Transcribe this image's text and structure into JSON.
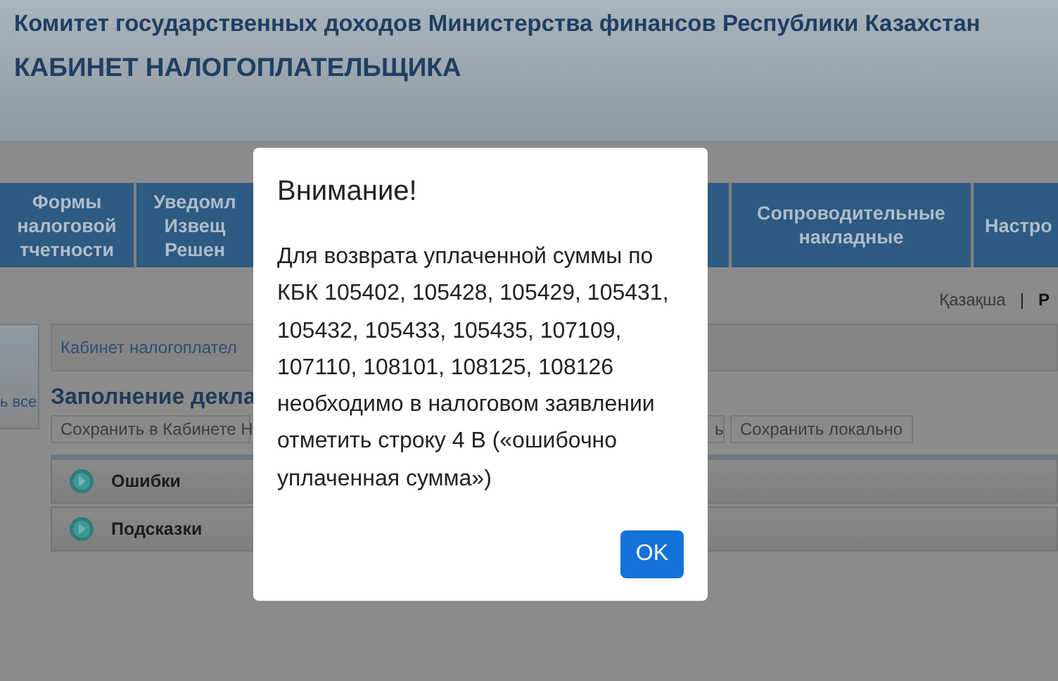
{
  "header": {
    "title": "Комитет государственных доходов Министерства финансов Республики Казахстан",
    "subtitle": "КАБИНЕТ НАЛОГОПЛАТЕЛЬЩИКА"
  },
  "nav": [
    {
      "lines": [
        "Формы",
        "налоговой",
        "тчетности"
      ],
      "kind": "full"
    },
    {
      "lines": [
        "Уведомл",
        "Извещ",
        "Решен"
      ],
      "kind": "covered"
    },
    {
      "kind": "sliver"
    },
    {
      "lines": [
        "Сопроводительные",
        "накладные"
      ],
      "kind": "wide"
    },
    {
      "lines": [
        "Настро"
      ],
      "kind": "edge"
    }
  ],
  "languages": {
    "separator": "|",
    "items": [
      {
        "label": "Қазақша",
        "selected": false
      },
      {
        "label": "Р",
        "selected": true
      }
    ]
  },
  "sidebar": {
    "link": "ь все"
  },
  "breadcrumb": "Кабинет налогоплател",
  "heading": "Заполнение декла",
  "actions": [
    {
      "label": "Сохранить в Кабинете Н",
      "kind": "wide"
    },
    {
      "label": "ь",
      "kind": "sliver"
    },
    {
      "label": "Сохранить локально",
      "kind": "normal"
    }
  ],
  "panels": [
    {
      "title": "Ошибки",
      "expanded": false
    },
    {
      "title": "Подсказки",
      "expanded": false
    }
  ],
  "dialog": {
    "title": "Внимание!",
    "message": "Для возврата уплаченной суммы по КБК 105402, 105428, 105429, 105431, 105432, 105433, 105435, 107109, 107110, 108101, 108125, 108126 необходимо в налоговом заявлении отметить строку 4 В («ошибочно уплаченная сумма»)",
    "button": "OK"
  }
}
